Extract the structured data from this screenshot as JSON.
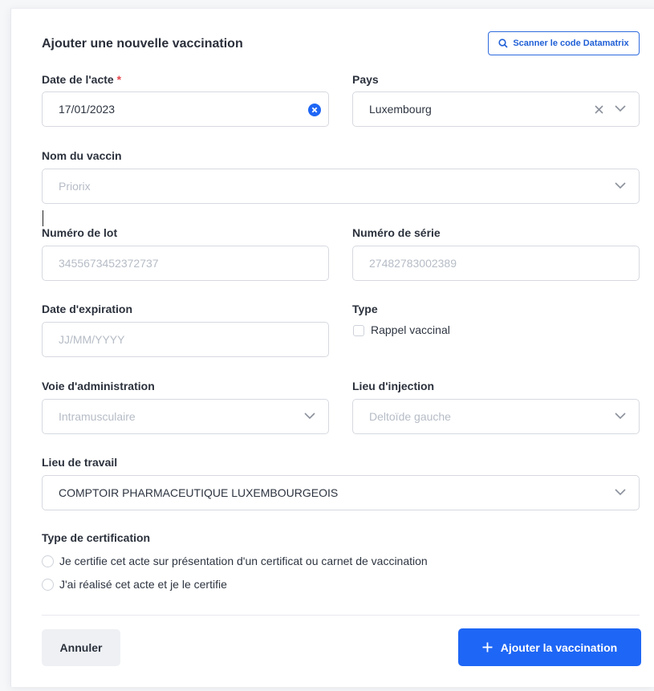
{
  "form": {
    "title": "Ajouter une nouvelle vaccination",
    "scan_button": "Scanner le code Datamatrix"
  },
  "fields": {
    "date_acte": {
      "label": "Date de l'acte",
      "required_mark": "*",
      "value": "17/01/2023"
    },
    "pays": {
      "label": "Pays",
      "value": "Luxembourg"
    },
    "nom_vaccin": {
      "label": "Nom du vaccin",
      "placeholder": "Priorix"
    },
    "numero_lot": {
      "label": "Numéro de lot",
      "placeholder": "3455673452372737"
    },
    "numero_serie": {
      "label": "Numéro de série",
      "placeholder": "27482783002389"
    },
    "date_expiration": {
      "label": "Date d'expiration",
      "placeholder": "JJ/MM/YYYY"
    },
    "type": {
      "label": "Type",
      "option": "Rappel vaccinal",
      "checked": false
    },
    "voie_administration": {
      "label": "Voie d'administration",
      "placeholder": "Intramusculaire"
    },
    "lieu_injection": {
      "label": "Lieu d'injection",
      "placeholder": "Deltoïde gauche"
    },
    "lieu_travail": {
      "label": "Lieu de travail",
      "value": "COMPTOIR PHARMACEUTIQUE LUXEMBOURGEOIS"
    },
    "certification": {
      "label": "Type de certification",
      "options": [
        "Je certifie cet acte sur présentation d'un certificat ou carnet de vaccination",
        "J'ai réalisé cet acte et je le certifie"
      ]
    }
  },
  "actions": {
    "cancel": "Annuler",
    "submit": "Ajouter la vaccination"
  },
  "colors": {
    "accent": "#1e66f5",
    "required": "#e5484d",
    "border": "#d6d9e0",
    "placeholder": "#b6bcc6"
  },
  "icons": [
    "search-icon",
    "clear-circle-icon",
    "clear-icon",
    "chevron-down-icon",
    "plus-icon"
  ]
}
